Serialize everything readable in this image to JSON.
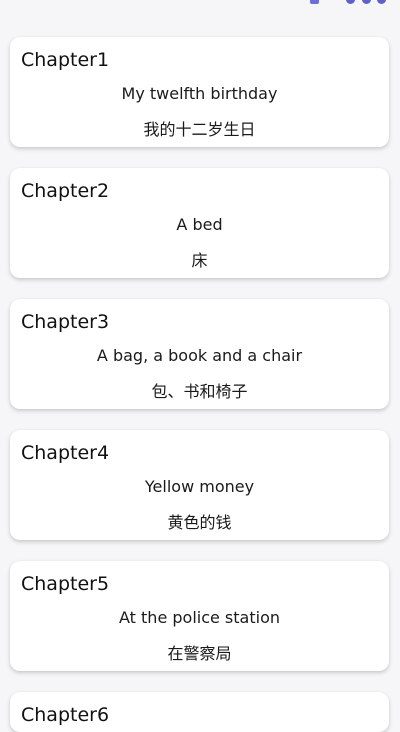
{
  "chapters": [
    {
      "title": "Chapter1",
      "english": "My twelfth birthday",
      "chinese": "我的十二岁生日"
    },
    {
      "title": "Chapter2",
      "english": "A bed",
      "chinese": "床"
    },
    {
      "title": "Chapter3",
      "english": "A bag, a book and a chair",
      "chinese": "包、书和椅子"
    },
    {
      "title": "Chapter4",
      "english": "Yellow money",
      "chinese": "黄色的钱"
    },
    {
      "title": "Chapter5",
      "english": "At the police station",
      "chinese": "在警察局"
    },
    {
      "title": "Chapter6"
    }
  ]
}
